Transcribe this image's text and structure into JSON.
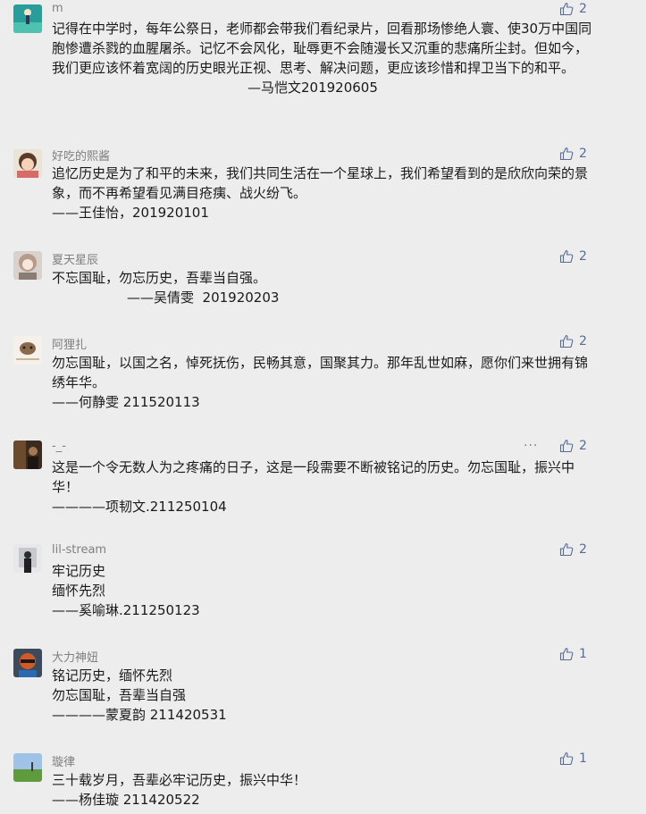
{
  "comments": [
    {
      "name": "m",
      "avatar": "teal-scene-avatar",
      "likes": "2",
      "lines": [
        "记得在中学时，每年公祭日，老师都会带我们看纪录片，回看那场惨绝人寰、使30万中国同胞惨遭杀戮的血腥屠杀。记忆不会风化，耻辱更不会随漫长又沉重的悲痛所尘封。但如今，我们更应该怀着宽阔的历史眼光正视、思考、解决问题，更应该珍惜和捍卫当下的和平。",
        "—马恺文201920605"
      ]
    },
    {
      "name": "好吃的熙酱",
      "avatar": "cartoon-girl-avatar",
      "likes": "2",
      "lines": [
        "追忆历史是为了和平的未来，我们共同生活在一个星球上，我们希望看到的是欣欣向荣的景象，而不再希望看见满目疮痍、战火纷飞。",
        "——王佳怡，201920101"
      ]
    },
    {
      "name": "夏天星辰",
      "avatar": "anime-girl-avatar",
      "likes": "2",
      "lines": [
        "不忘国耻，勿忘历史，吾辈当自强。",
        "——吴倩雯  201920203"
      ]
    },
    {
      "name": "阿狸扎",
      "avatar": "cow-cartoon-avatar",
      "likes": "2",
      "lines": [
        "勿忘国耻，以国之名，悼死抚伤，民畅其意，国聚其力。那年乱世如麻，愿你们来世拥有锦绣年华。",
        "——何静雯 211520113"
      ]
    },
    {
      "name": "-_-",
      "avatar": "dark-photo-avatar",
      "likes": "2",
      "more": "···",
      "lines": [
        "这是一个令无数人为之疼痛的日子，这是一段需要不断被铭记的历史。勿忘国耻，振兴中华！",
        "————项韧文.211250104"
      ]
    },
    {
      "name": "lil-stream",
      "avatar": "figure-photo-avatar",
      "likes": "2",
      "lines": [
        "牢记历史",
        "缅怀先烈",
        "——奚喻琳.211250123"
      ]
    },
    {
      "name": "大力神妞",
      "avatar": "mario-cartoon-avatar",
      "likes": "1",
      "lines": [
        "铭记历史，缅怀先烈",
        "勿忘国耻，吾辈当自强",
        "————蒙夏韵 211420531"
      ]
    },
    {
      "name": "璇律",
      "avatar": "landscape-photo-avatar",
      "likes": "1",
      "lines": [
        "三十载岁月，吾辈必牢记历史，振兴中华！",
        "——杨佳璇 211420522"
      ]
    }
  ]
}
